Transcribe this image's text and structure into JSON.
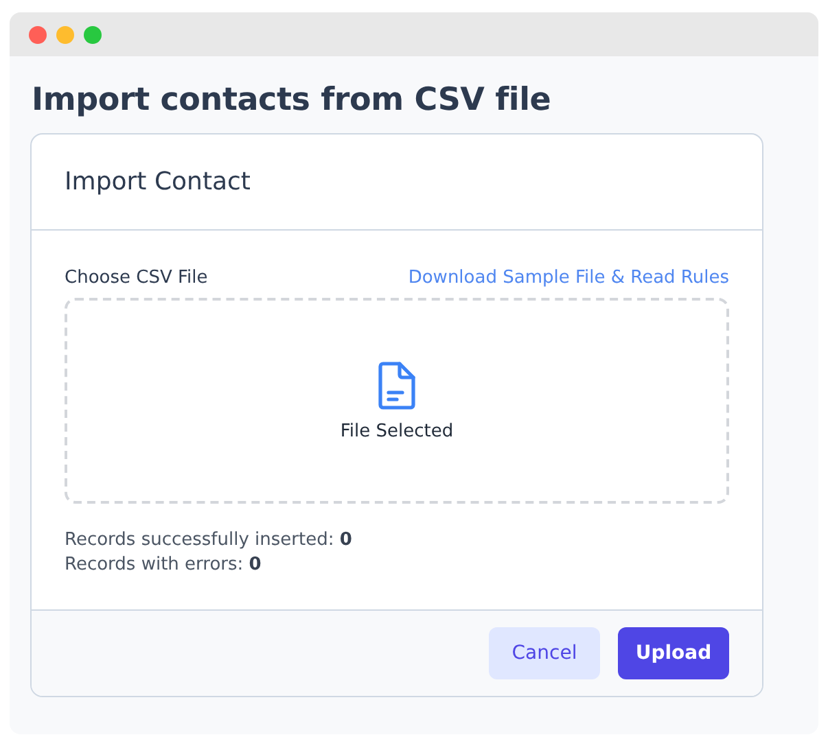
{
  "window": {
    "controls": [
      {
        "color": "#ff5f57"
      },
      {
        "color": "#febc2e"
      },
      {
        "color": "#28c840"
      }
    ]
  },
  "page_title": "Import contacts from CSV file",
  "card": {
    "title": "Import Contact",
    "file_label": "Choose CSV File",
    "sample_link": "Download Sample File & Read Rules",
    "dropzone": {
      "status": "File Selected"
    },
    "stats": [
      "Records successfully inserted: **0**",
      "Records with errors: **0**"
    ],
    "buttons": [
      {
        "label": "Cancel",
        "kind": "secondary"
      },
      {
        "label": "Upload",
        "kind": "primary"
      }
    ]
  }
}
